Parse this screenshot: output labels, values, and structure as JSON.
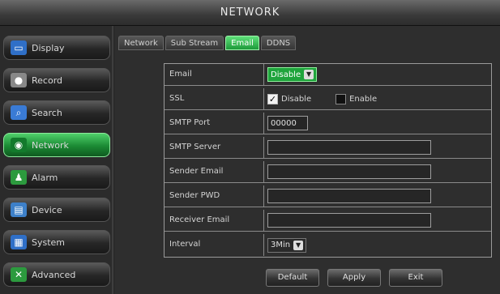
{
  "window": {
    "title": "NETWORK"
  },
  "sidebar": {
    "items": [
      {
        "label": "Display",
        "icon": "monitor-icon",
        "active": false
      },
      {
        "label": "Record",
        "icon": "record-icon",
        "active": false
      },
      {
        "label": "Search",
        "icon": "search-icon",
        "active": false
      },
      {
        "label": "Network",
        "icon": "network-icon",
        "active": true
      },
      {
        "label": "Alarm",
        "icon": "alarm-icon",
        "active": false
      },
      {
        "label": "Device",
        "icon": "device-icon",
        "active": false
      },
      {
        "label": "System",
        "icon": "system-icon",
        "active": false
      },
      {
        "label": "Advanced",
        "icon": "advanced-icon",
        "active": false
      }
    ]
  },
  "tabs": [
    {
      "label": "Network",
      "active": false
    },
    {
      "label": "Sub Stream",
      "active": false
    },
    {
      "label": "Email",
      "active": true
    },
    {
      "label": "DDNS",
      "active": false
    }
  ],
  "form": {
    "email": {
      "label": "Email",
      "value": "Disable"
    },
    "ssl": {
      "label": "SSL",
      "options": [
        "Disable",
        "Enable"
      ],
      "selected": "Disable"
    },
    "smtp_port": {
      "label": "SMTP Port",
      "value": "00000"
    },
    "smtp_server": {
      "label": "SMTP Server",
      "value": ""
    },
    "sender_email": {
      "label": "Sender Email",
      "value": ""
    },
    "sender_pwd": {
      "label": "Sender PWD",
      "value": ""
    },
    "receiver_email": {
      "label": "Receiver Email",
      "value": ""
    },
    "interval": {
      "label": "Interval",
      "value": "3Min"
    }
  },
  "buttons": {
    "default": "Default",
    "apply": "Apply",
    "exit": "Exit"
  },
  "colors": {
    "accent": "#1fa43c",
    "background": "#2e2e2e"
  }
}
